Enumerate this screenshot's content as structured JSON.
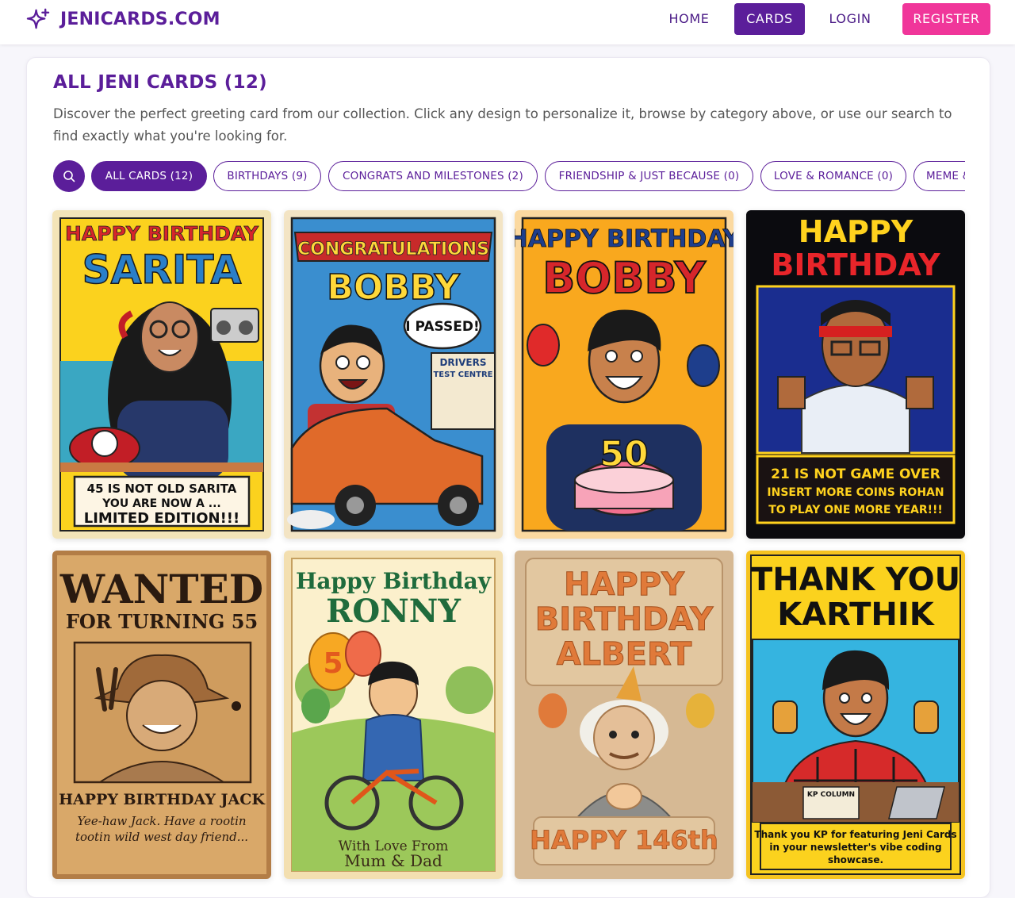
{
  "brand": {
    "name": "JENICARDS.COM",
    "icon": "sparkle-icon"
  },
  "nav": {
    "home": "HOME",
    "cards": "CARDS",
    "login": "LOGIN",
    "register": "REGISTER"
  },
  "page": {
    "title": "ALL JENI CARDS (12)",
    "description": "Discover the perfect greeting card from our collection. Click any design to personalize it, browse by category above, or use our search to find exactly what you're looking for."
  },
  "filters": {
    "search_icon": "search-icon",
    "chips": [
      "ALL CARDS (12)",
      "BIRTHDAYS (9)",
      "CONGRATS AND MILESTONES (2)",
      "FRIENDSHIP & JUST BECAUSE (0)",
      "LOVE & ROMANCE (0)",
      "MEME & FUN"
    ]
  },
  "cards": [
    {
      "top": "HAPPY BIRTHDAY",
      "name": "SARITA",
      "bottom": [
        "45 IS NOT OLD SARITA",
        "YOU ARE NOW A ...",
        "LIMITED EDITION!!!"
      ]
    },
    {
      "top": "CONGRATULATIONS",
      "name": "BOBBY",
      "bubble": "I PASSED!",
      "sign": [
        "DRIVERS",
        "TEST CENTRE"
      ]
    },
    {
      "top": "HAPPY BIRTHDAY",
      "name": "BOBBY",
      "number": "50"
    },
    {
      "top": "HAPPY",
      "name": "BIRTHDAY",
      "bottom": [
        "21 IS NOT GAME OVER",
        "INSERT MORE COINS ROHAN",
        "TO PLAY ONE MORE YEAR!!!"
      ]
    },
    {
      "top": "WANTED",
      "name": "FOR TURNING 55",
      "bottom": [
        "HAPPY BIRTHDAY JACK",
        "Yee-haw Jack. Have a rootin",
        "tootin wild west day friend..."
      ]
    },
    {
      "top": "Happy Birthday",
      "name": "RONNY",
      "number": "5",
      "bottom": [
        "With Love From",
        "Mum & Dad"
      ]
    },
    {
      "top": "HAPPY",
      "name": "BIRTHDAY",
      "name2": "ALBERT",
      "bottom": [
        "HAPPY 146th"
      ]
    },
    {
      "top": "THANK YOU",
      "name": "KARTHIK",
      "tag": "KP COLUMN",
      "bottom": [
        "Thank you KP for featuring Jeni Cards",
        "in your newsletter's vibe coding",
        "showcase."
      ]
    }
  ]
}
